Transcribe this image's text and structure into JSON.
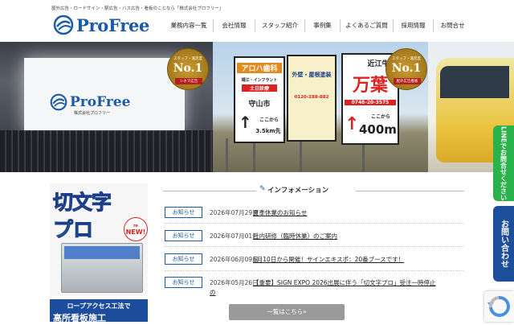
{
  "header": {
    "tagline": "屋外広告・ロードサイン・駅広告・バス広告・看板のことなら「株式会社プロフリー」",
    "logo_text": "ProFree",
    "nav": [
      "業務内容一覧",
      "会社情報",
      "スタッフ紹介",
      "事例集",
      "よくあるご質問",
      "採用情報",
      "お問合せ"
    ]
  },
  "hero": {
    "screen_logo": "ProFree",
    "screen_sub": "株式会社プロフリー",
    "badge_left": {
      "top": "スタッフ・満足度",
      "no1": "No.1",
      "sub": "シネマ広告"
    },
    "badge_right": {
      "top": "スタッフ・満足度",
      "no1": "No.1",
      "sub": "屋外広告看板"
    },
    "billboards": {
      "b1_top": "アロハ歯科",
      "b1_mid": "靖江・インフラント",
      "b1_clinic": "土日診療",
      "b1_city": "守山市",
      "b1_arrow": "ここから",
      "b1_dist": "3.5km先",
      "b2_top": "外壁・屋根塗装",
      "b2_phone": "0120-288-882",
      "b3_top": "近江牛",
      "b3_big": "万葉",
      "b3_phone": "0748-20-3575",
      "b3_here": "ここから",
      "b3_dist": "400m"
    }
  },
  "side_tabs": {
    "line": "LINEでお問合せください",
    "mail": "お問い合わせ"
  },
  "promo": {
    "line1": "切文字",
    "line2": "プロ",
    "new_small": "re",
    "new_big": "NEW!",
    "banner_line1": "ロープアクセス工法で",
    "banner_line2": "高所看板施工"
  },
  "info": {
    "heading": "インフォメーション",
    "items": [
      {
        "tag": "お知らせ",
        "date": "2026年07月29日",
        "title": "夏季休業のお知らせ"
      },
      {
        "tag": "お知らせ",
        "date": "2026年07月01日",
        "title": "社内研修（臨時休業）のご案内"
      },
      {
        "tag": "お知らせ",
        "date": "2026年06月09日",
        "title": "6月10日から開催！サインエキスポ：20番ブースです！"
      },
      {
        "tag": "お知らせ",
        "date": "2026年05月26日",
        "title": "【重要】SIGN EXPO 2026出展に伴う「切文字プロ」受注一時停止",
        "cont": "の"
      }
    ],
    "more_label": "一覧はこちら»"
  },
  "colors": {
    "brand": "#1a5aa8",
    "line_green": "#2ab34a",
    "mail_blue": "#1c4e9a"
  }
}
